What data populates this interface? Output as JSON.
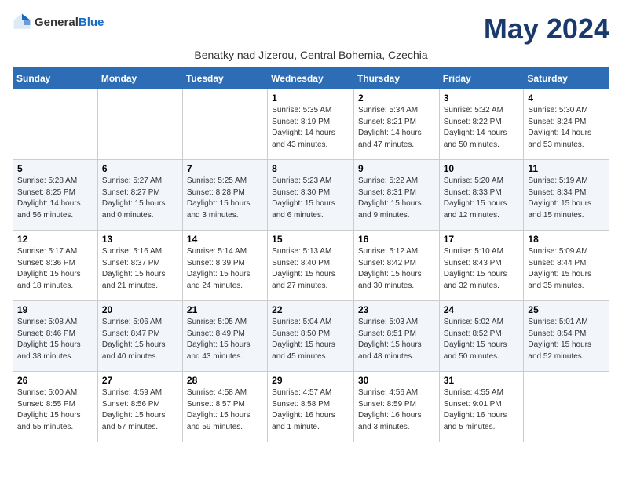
{
  "logo": {
    "general": "General",
    "blue": "Blue"
  },
  "title": "May 2024",
  "subtitle": "Benatky nad Jizerou, Central Bohemia, Czechia",
  "days_of_week": [
    "Sunday",
    "Monday",
    "Tuesday",
    "Wednesday",
    "Thursday",
    "Friday",
    "Saturday"
  ],
  "weeks": [
    [
      {
        "day": "",
        "info": ""
      },
      {
        "day": "",
        "info": ""
      },
      {
        "day": "",
        "info": ""
      },
      {
        "day": "1",
        "info": "Sunrise: 5:35 AM\nSunset: 8:19 PM\nDaylight: 14 hours\nand 43 minutes."
      },
      {
        "day": "2",
        "info": "Sunrise: 5:34 AM\nSunset: 8:21 PM\nDaylight: 14 hours\nand 47 minutes."
      },
      {
        "day": "3",
        "info": "Sunrise: 5:32 AM\nSunset: 8:22 PM\nDaylight: 14 hours\nand 50 minutes."
      },
      {
        "day": "4",
        "info": "Sunrise: 5:30 AM\nSunset: 8:24 PM\nDaylight: 14 hours\nand 53 minutes."
      }
    ],
    [
      {
        "day": "5",
        "info": "Sunrise: 5:28 AM\nSunset: 8:25 PM\nDaylight: 14 hours\nand 56 minutes."
      },
      {
        "day": "6",
        "info": "Sunrise: 5:27 AM\nSunset: 8:27 PM\nDaylight: 15 hours\nand 0 minutes."
      },
      {
        "day": "7",
        "info": "Sunrise: 5:25 AM\nSunset: 8:28 PM\nDaylight: 15 hours\nand 3 minutes."
      },
      {
        "day": "8",
        "info": "Sunrise: 5:23 AM\nSunset: 8:30 PM\nDaylight: 15 hours\nand 6 minutes."
      },
      {
        "day": "9",
        "info": "Sunrise: 5:22 AM\nSunset: 8:31 PM\nDaylight: 15 hours\nand 9 minutes."
      },
      {
        "day": "10",
        "info": "Sunrise: 5:20 AM\nSunset: 8:33 PM\nDaylight: 15 hours\nand 12 minutes."
      },
      {
        "day": "11",
        "info": "Sunrise: 5:19 AM\nSunset: 8:34 PM\nDaylight: 15 hours\nand 15 minutes."
      }
    ],
    [
      {
        "day": "12",
        "info": "Sunrise: 5:17 AM\nSunset: 8:36 PM\nDaylight: 15 hours\nand 18 minutes."
      },
      {
        "day": "13",
        "info": "Sunrise: 5:16 AM\nSunset: 8:37 PM\nDaylight: 15 hours\nand 21 minutes."
      },
      {
        "day": "14",
        "info": "Sunrise: 5:14 AM\nSunset: 8:39 PM\nDaylight: 15 hours\nand 24 minutes."
      },
      {
        "day": "15",
        "info": "Sunrise: 5:13 AM\nSunset: 8:40 PM\nDaylight: 15 hours\nand 27 minutes."
      },
      {
        "day": "16",
        "info": "Sunrise: 5:12 AM\nSunset: 8:42 PM\nDaylight: 15 hours\nand 30 minutes."
      },
      {
        "day": "17",
        "info": "Sunrise: 5:10 AM\nSunset: 8:43 PM\nDaylight: 15 hours\nand 32 minutes."
      },
      {
        "day": "18",
        "info": "Sunrise: 5:09 AM\nSunset: 8:44 PM\nDaylight: 15 hours\nand 35 minutes."
      }
    ],
    [
      {
        "day": "19",
        "info": "Sunrise: 5:08 AM\nSunset: 8:46 PM\nDaylight: 15 hours\nand 38 minutes."
      },
      {
        "day": "20",
        "info": "Sunrise: 5:06 AM\nSunset: 8:47 PM\nDaylight: 15 hours\nand 40 minutes."
      },
      {
        "day": "21",
        "info": "Sunrise: 5:05 AM\nSunset: 8:49 PM\nDaylight: 15 hours\nand 43 minutes."
      },
      {
        "day": "22",
        "info": "Sunrise: 5:04 AM\nSunset: 8:50 PM\nDaylight: 15 hours\nand 45 minutes."
      },
      {
        "day": "23",
        "info": "Sunrise: 5:03 AM\nSunset: 8:51 PM\nDaylight: 15 hours\nand 48 minutes."
      },
      {
        "day": "24",
        "info": "Sunrise: 5:02 AM\nSunset: 8:52 PM\nDaylight: 15 hours\nand 50 minutes."
      },
      {
        "day": "25",
        "info": "Sunrise: 5:01 AM\nSunset: 8:54 PM\nDaylight: 15 hours\nand 52 minutes."
      }
    ],
    [
      {
        "day": "26",
        "info": "Sunrise: 5:00 AM\nSunset: 8:55 PM\nDaylight: 15 hours\nand 55 minutes."
      },
      {
        "day": "27",
        "info": "Sunrise: 4:59 AM\nSunset: 8:56 PM\nDaylight: 15 hours\nand 57 minutes."
      },
      {
        "day": "28",
        "info": "Sunrise: 4:58 AM\nSunset: 8:57 PM\nDaylight: 15 hours\nand 59 minutes."
      },
      {
        "day": "29",
        "info": "Sunrise: 4:57 AM\nSunset: 8:58 PM\nDaylight: 16 hours\nand 1 minute."
      },
      {
        "day": "30",
        "info": "Sunrise: 4:56 AM\nSunset: 8:59 PM\nDaylight: 16 hours\nand 3 minutes."
      },
      {
        "day": "31",
        "info": "Sunrise: 4:55 AM\nSunset: 9:01 PM\nDaylight: 16 hours\nand 5 minutes."
      },
      {
        "day": "",
        "info": ""
      }
    ]
  ]
}
